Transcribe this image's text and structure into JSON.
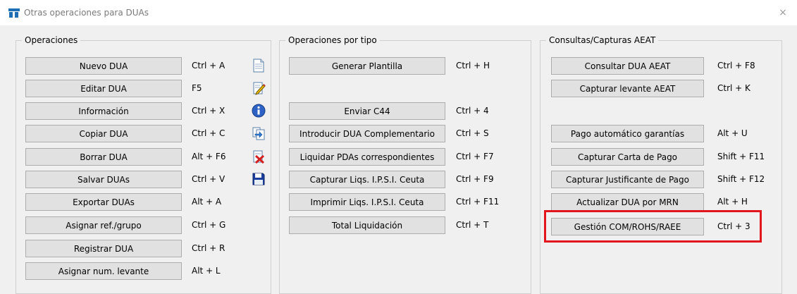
{
  "window": {
    "title": "Otras operaciones para DUAs",
    "close_glyph": "×"
  },
  "operaciones": {
    "legend": "Operaciones",
    "items": [
      {
        "label": "Nuevo DUA",
        "shortcut": "Ctrl + A",
        "icon": "new-document-icon"
      },
      {
        "label": "Editar DUA",
        "shortcut": "F5",
        "icon": "edit-document-icon"
      },
      {
        "label": "Información",
        "shortcut": "Ctrl + X",
        "icon": "info-icon"
      },
      {
        "label": "Copiar DUA",
        "shortcut": "Ctrl + C",
        "icon": "copy-document-icon"
      },
      {
        "label": "Borrar DUA",
        "shortcut": "Alt + F6",
        "icon": "delete-document-icon"
      },
      {
        "label": "Salvar DUAs",
        "shortcut": "Ctrl + V",
        "icon": "save-icon"
      },
      {
        "label": "Exportar DUAs",
        "shortcut": "Alt + A"
      },
      {
        "label": "Asignar ref./grupo",
        "shortcut": "Ctrl + G"
      },
      {
        "label": "Registrar DUA",
        "shortcut": "Ctrl + R"
      },
      {
        "label": "Asignar num. levante",
        "shortcut": "Alt + L"
      }
    ]
  },
  "por_tipo": {
    "legend": "Operaciones por tipo",
    "items": [
      {
        "label": "Generar Plantilla",
        "shortcut": "Ctrl + H"
      },
      {
        "label": "Enviar C44",
        "shortcut": "Ctrl + 4"
      },
      {
        "label": "Introducir DUA Complementario",
        "shortcut": "Ctrl + S"
      },
      {
        "label": "Liquidar PDAs correspondientes",
        "shortcut": "Ctrl + F7"
      },
      {
        "label": "Capturar Liqs. I.P.S.I. Ceuta",
        "shortcut": "Ctrl + F9"
      },
      {
        "label": "Imprimir Liqs. I.P.S.I. Ceuta",
        "shortcut": "Ctrl + F11"
      },
      {
        "label": "Total Liquidación",
        "shortcut": "Ctrl + T"
      }
    ]
  },
  "consultas": {
    "legend": "Consultas/Capturas AEAT",
    "items": [
      {
        "label": "Consultar DUA AEAT",
        "shortcut": "Ctrl + F8"
      },
      {
        "label": "Capturar levante AEAT",
        "shortcut": "Ctrl + K"
      },
      {
        "label": "Pago automático garantías",
        "shortcut": "Alt + U"
      },
      {
        "label": "Capturar Carta de Pago",
        "shortcut": "Shift + F11"
      },
      {
        "label": "Capturar Justificante de Pago",
        "shortcut": "Shift + F12"
      },
      {
        "label": "Actualizar DUA por MRN",
        "shortcut": "Alt + H"
      },
      {
        "label": "Gestión COM/ROHS/RAEE",
        "shortcut": "Ctrl + 3"
      }
    ]
  },
  "colors": {
    "highlight": "#e3151c",
    "title_icon": "#1e6eb4"
  }
}
